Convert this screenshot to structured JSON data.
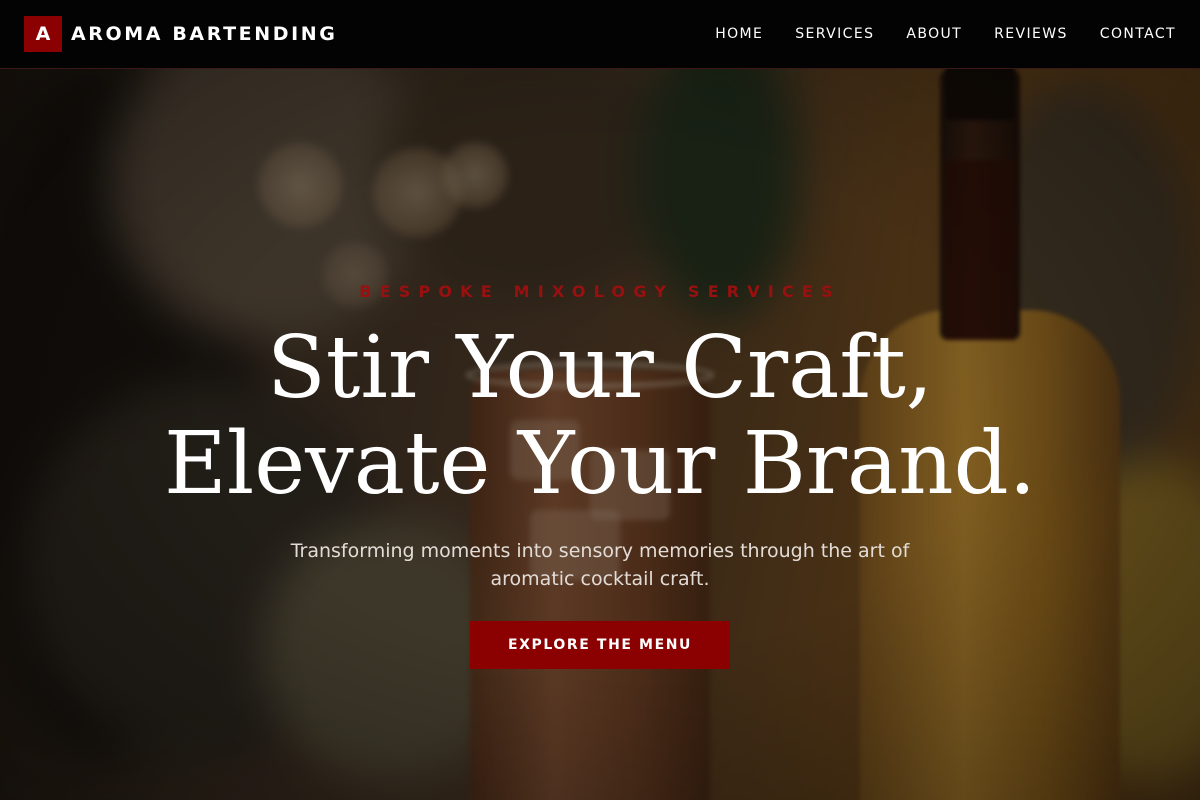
{
  "header": {
    "logo_letter": "A",
    "brand_name": "AROMA BARTENDING",
    "nav": [
      {
        "label": "HOME"
      },
      {
        "label": "SERVICES"
      },
      {
        "label": "ABOUT"
      },
      {
        "label": "REVIEWS"
      },
      {
        "label": "CONTACT"
      }
    ]
  },
  "hero": {
    "eyebrow": "BESPOKE MIXOLOGY SERVICES",
    "headline_line1": "Stir Your Craft,",
    "headline_line2": "Elevate Your Brand.",
    "subtitle": "Transforming moments into sensory memories through the art of aromatic cocktail craft.",
    "cta_label": "EXPLORE THE MENU",
    "background_image": "blurred-bar-cocktail-photo"
  },
  "colors": {
    "accent": "#8b0000",
    "nav_background": "#040303",
    "text_light": "#ffffff"
  }
}
